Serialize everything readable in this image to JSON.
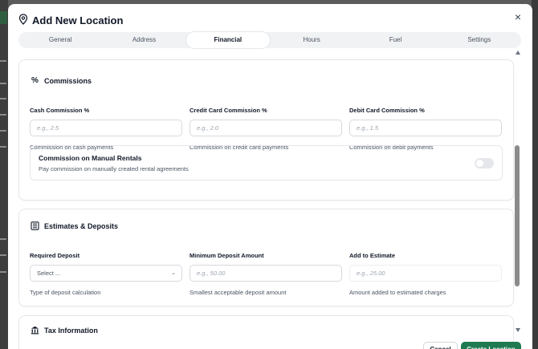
{
  "modal": {
    "title": "Add New Location",
    "close_glyph": "×"
  },
  "tabs": [
    {
      "label": "General",
      "active": false
    },
    {
      "label": "Address",
      "active": false
    },
    {
      "label": "Financial",
      "active": true
    },
    {
      "label": "Hours",
      "active": false
    },
    {
      "label": "Fuel",
      "active": false
    },
    {
      "label": "Settings",
      "active": false
    }
  ],
  "commissions": {
    "icon": "percent-icon",
    "icon_glyph": "%",
    "title": "Commissions",
    "fields": [
      {
        "label": "Cash Commission %",
        "placeholder": "e.g., 2.5",
        "help": "Commission on cash payments"
      },
      {
        "label": "Credit Card Commission %",
        "placeholder": "e.g., 2.0",
        "help": "Commission on credit card payments"
      },
      {
        "label": "Debit Card Commission %",
        "placeholder": "e.g., 1.5",
        "help": "Commission on debit payments"
      }
    ],
    "manual_rentals": {
      "title": "Commission on Manual Rentals",
      "description": "Pay commission on manually created rental agreements",
      "enabled": false
    }
  },
  "estimates": {
    "icon": "calculator-icon",
    "title": "Estimates & Deposits",
    "required_deposit": {
      "label": "Required Deposit",
      "value": "Select ...",
      "help": "Type of deposit calculation"
    },
    "minimum_deposit": {
      "label": "Minimum Deposit Amount",
      "placeholder": "e.g., 50.00",
      "help": "Smallest acceptable deposit amount"
    },
    "add_to_estimate": {
      "label": "Add to Estimate",
      "placeholder": "e.g., 25.00",
      "help": "Amount added to estimated charges"
    }
  },
  "tax": {
    "icon": "bank-icon",
    "title": "Tax Information"
  },
  "footer": {
    "cancel_label": "Cancel",
    "create_label": "Create Location"
  },
  "colors": {
    "primary": "#1f7a52",
    "overlay": "#5b5b5b"
  }
}
